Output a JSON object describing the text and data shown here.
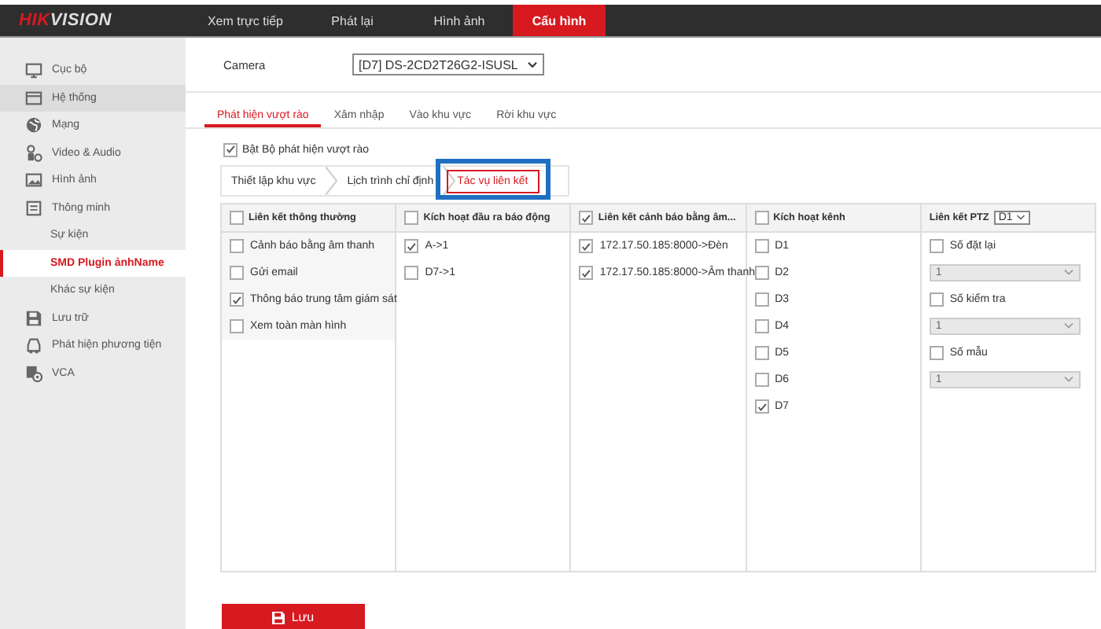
{
  "brand": {
    "accent": "HIK",
    "rest": "VISION"
  },
  "nav": [
    {
      "label": "Xem trực tiếp",
      "selected": false
    },
    {
      "label": "Phát lại",
      "selected": false
    },
    {
      "label": "Hình ảnh",
      "selected": false
    },
    {
      "label": "Cấu hình",
      "selected": true
    }
  ],
  "sidebar": {
    "items": [
      {
        "label": "Cục bộ",
        "selected": false,
        "hovered": false
      },
      {
        "label": "Hệ thống",
        "selected": false,
        "hovered": true
      },
      {
        "label": "Mạng",
        "selected": false,
        "hovered": false
      },
      {
        "label": "Video & Audio",
        "selected": false,
        "hovered": false
      },
      {
        "label": "Hình ảnh",
        "selected": false,
        "hovered": false
      },
      {
        "label": "Thông minh",
        "selected": false,
        "hovered": false,
        "children": [
          {
            "label": "Sự kiện",
            "selected": false,
            "hovered": false
          },
          {
            "label": "SMD Plugin ảnhName",
            "selected": true,
            "hovered": false
          },
          {
            "label": "Khác sự kiện",
            "selected": false,
            "hovered": false
          }
        ]
      },
      {
        "label": "Lưu trữ",
        "selected": false,
        "hovered": false
      },
      {
        "label": "Phát hiện phương tiện",
        "selected": false,
        "hovered": false
      },
      {
        "label": "VCA",
        "selected": false,
        "hovered": false
      }
    ]
  },
  "camera": {
    "label": "Camera",
    "value": "[D7] DS-2CD2T26G2-ISUSL"
  },
  "sub_tabs": [
    {
      "label": "Phát hiện vượt rào",
      "selected": true
    },
    {
      "label": "Xâm nhập",
      "selected": false
    },
    {
      "label": "Vào khu vực",
      "selected": false
    },
    {
      "label": "Rời khu vực",
      "selected": false
    }
  ],
  "enable": {
    "label": "Bật Bộ phát hiện vượt rào",
    "checked": true
  },
  "steps": [
    {
      "label": "Thiết lập khu vực",
      "selected": false,
      "highlighted": false
    },
    {
      "label": "Lịch trình chỉ định",
      "selected": false,
      "highlighted": false
    },
    {
      "label": "Tác vụ liên kết",
      "selected": true,
      "highlighted": true
    }
  ],
  "table": {
    "columns": [
      {
        "kind": "check",
        "label": "Liên kết thông thường",
        "checked": false,
        "items": [
          {
            "kind": "check",
            "label": "Cảnh báo bằng âm thanh",
            "checked": false
          },
          {
            "kind": "check",
            "label": "Gửi email",
            "checked": false
          },
          {
            "kind": "check",
            "label": "Thông báo trung tâm giám sát",
            "checked": true
          },
          {
            "kind": "check",
            "label": "Xem toàn màn hình",
            "checked": false
          }
        ]
      },
      {
        "kind": "check",
        "label": "Kích hoạt đầu ra báo động",
        "checked": false,
        "items": [
          {
            "kind": "check",
            "label": "A->1",
            "checked": true
          },
          {
            "kind": "check",
            "label": "D7->1",
            "checked": false
          }
        ]
      },
      {
        "kind": "check",
        "label": "Liên kết cảnh báo bằng âm...",
        "checked": true,
        "items": [
          {
            "kind": "check",
            "label": "172.17.50.185:8000->Đèn",
            "checked": true
          },
          {
            "kind": "check",
            "label": "172.17.50.185:8000->Âm thanh",
            "checked": true
          }
        ]
      },
      {
        "kind": "check",
        "label": "Kích hoạt kênh",
        "checked": false,
        "items": [
          {
            "kind": "check",
            "label": "D1",
            "checked": false
          },
          {
            "kind": "check",
            "label": "D2",
            "checked": false
          },
          {
            "kind": "check",
            "label": "D3",
            "checked": false
          },
          {
            "kind": "check",
            "label": "D4",
            "checked": false
          },
          {
            "kind": "check",
            "label": "D5",
            "checked": false
          },
          {
            "kind": "check",
            "label": "D6",
            "checked": false
          },
          {
            "kind": "check",
            "label": "D7",
            "checked": true
          }
        ]
      },
      {
        "kind": "ptz",
        "label": "Liên kết PTZ",
        "select": "D1",
        "items": [
          {
            "kind": "check",
            "label": "Số đặt lại",
            "checked": false
          },
          {
            "kind": "select",
            "value": "1",
            "disabled": true
          },
          {
            "kind": "check",
            "label": "Số kiểm tra",
            "checked": false
          },
          {
            "kind": "select",
            "value": "1",
            "disabled": true
          },
          {
            "kind": "check",
            "label": "Số mẫu",
            "checked": false
          },
          {
            "kind": "select",
            "value": "1",
            "disabled": true
          }
        ]
      }
    ]
  },
  "save_button": {
    "label": "Lưu"
  }
}
